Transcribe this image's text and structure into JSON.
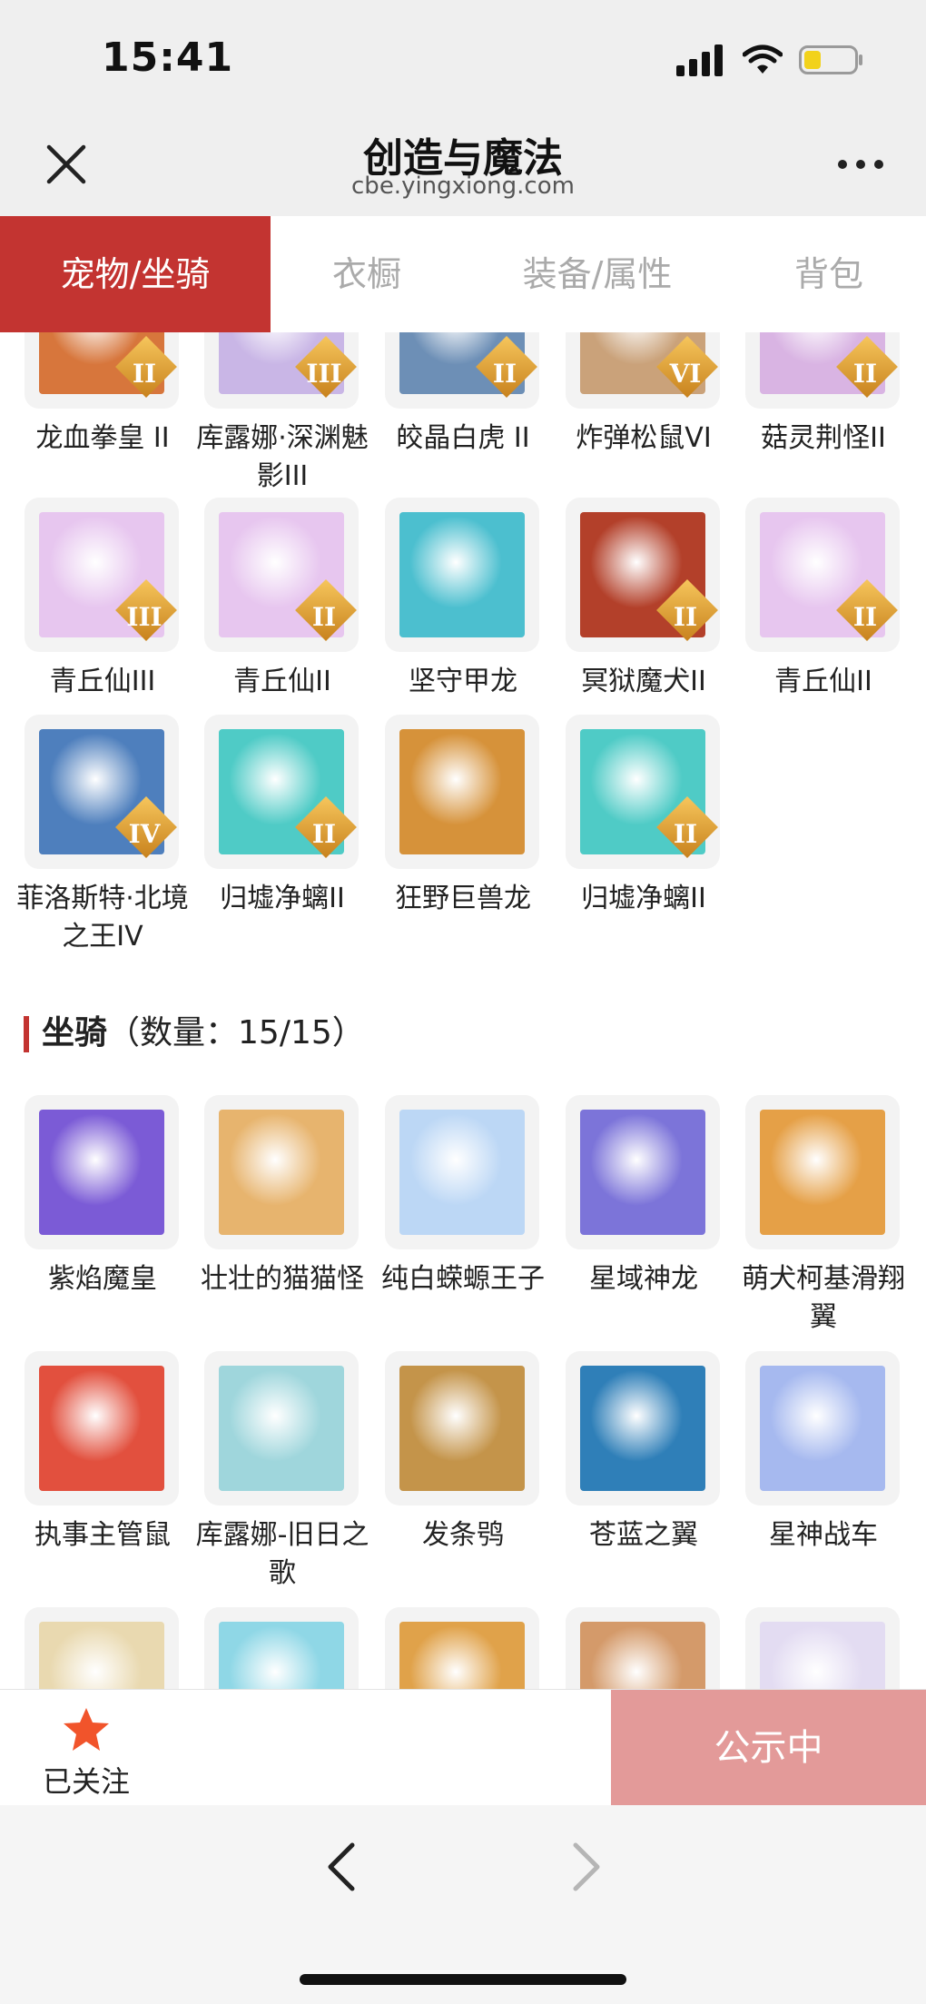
{
  "status": {
    "time": "15:41"
  },
  "nav": {
    "title": "创造与魔法",
    "subtitle": "cbe.yingxiong.com"
  },
  "tabs": [
    {
      "label": "宠物/坐骑",
      "active": true
    },
    {
      "label": "衣橱",
      "active": false
    },
    {
      "label": "装备/属性",
      "active": false
    },
    {
      "label": "背包",
      "active": false
    }
  ],
  "pets": [
    {
      "name": "龙血拳皇 II",
      "rank": "II",
      "color": "#d7763c"
    },
    {
      "name": "库露娜·深渊魅影III",
      "rank": "III",
      "color": "#c9b6e6"
    },
    {
      "name": "皎晶白虎 II",
      "rank": "II",
      "color": "#6d8fb6"
    },
    {
      "name": "炸弹松鼠VI",
      "rank": "VI",
      "color": "#caa27a"
    },
    {
      "name": "菇灵荆怪II",
      "rank": "II",
      "color": "#d9b4e3"
    },
    {
      "name": "青丘仙III",
      "rank": "III",
      "color": "#e7c6ef"
    },
    {
      "name": "青丘仙II",
      "rank": "II",
      "color": "#e7c6ef"
    },
    {
      "name": "坚守甲龙",
      "rank": "",
      "color": "#4cbfcf"
    },
    {
      "name": "冥狱魔犬II",
      "rank": "II",
      "color": "#b3402a"
    },
    {
      "name": "青丘仙II",
      "rank": "II",
      "color": "#e7c6ef"
    },
    {
      "name": "菲洛斯特·北境之王IV",
      "rank": "IV",
      "color": "#4e7fbd"
    },
    {
      "name": "归墟净螭II",
      "rank": "II",
      "color": "#4fcbc6"
    },
    {
      "name": "狂野巨兽龙",
      "rank": "",
      "color": "#d6923a"
    },
    {
      "name": "归墟净螭II",
      "rank": "II",
      "color": "#4fcbc6"
    }
  ],
  "mounts_section": {
    "title": "坐骑",
    "count_text": "（数量：15/15）"
  },
  "mounts": [
    {
      "name": "紫焰魔皇",
      "color": "#7b5bd6"
    },
    {
      "name": "壮壮的猫猫怪",
      "color": "#e7b46e"
    },
    {
      "name": "纯白蝾螈王子",
      "color": "#bcd7f5"
    },
    {
      "name": "星域神龙",
      "color": "#7c74d9"
    },
    {
      "name": "萌犬柯基滑翔翼",
      "color": "#e5a047"
    },
    {
      "name": "执事主管鼠",
      "color": "#e2503e"
    },
    {
      "name": "库露娜-旧日之歌",
      "color": "#9fd6dc"
    },
    {
      "name": "发条鸮",
      "color": "#c4944a"
    },
    {
      "name": "苍蓝之翼",
      "color": "#2f7fb8"
    },
    {
      "name": "星神战车",
      "color": "#a6b9ef"
    },
    {
      "name": "",
      "color": "#e9d9b0"
    },
    {
      "name": "",
      "color": "#8fd7e6"
    },
    {
      "name": "",
      "color": "#e0a24a"
    },
    {
      "name": "",
      "color": "#d49a6a"
    },
    {
      "name": "",
      "color": "#e3dcf2"
    }
  ],
  "bottom": {
    "follow_label": "已关注",
    "status_button": "公示中"
  },
  "colors": {
    "accent": "#c33431",
    "status_button": "#e39a99",
    "star": "#f1542b"
  }
}
